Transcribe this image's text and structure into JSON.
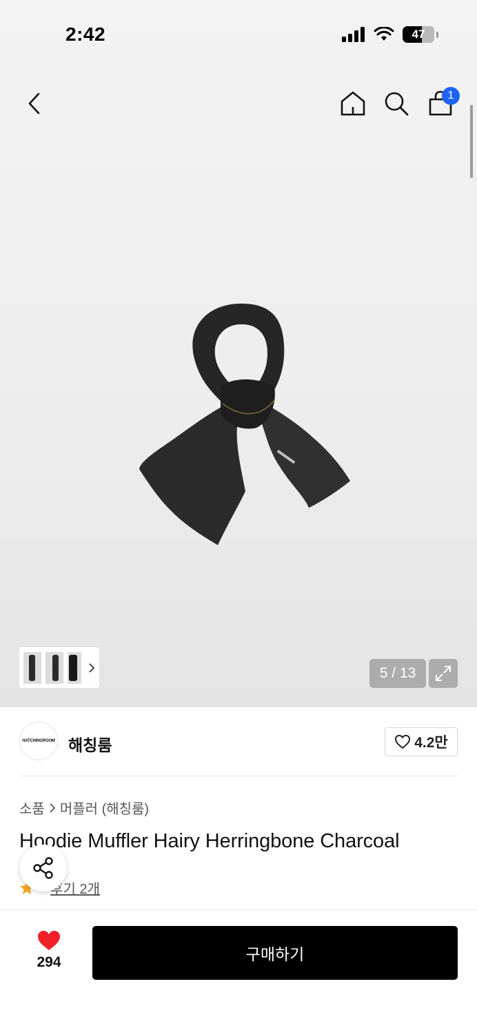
{
  "status_bar": {
    "time": "2:42",
    "battery": "47"
  },
  "nav": {
    "cart_count": "1"
  },
  "gallery": {
    "counter": "5 / 13",
    "current_index": 5,
    "total": 13
  },
  "brand": {
    "logo_text": "HATCHINGROOM",
    "name": "해칭룸",
    "likes": "4.2만"
  },
  "breadcrumb": {
    "category": "소품",
    "subcategory": "머플러 (해칭룸)"
  },
  "product": {
    "title": "Hoodie Muffler Hairy Herringbone Charcoal",
    "rating": "5",
    "reviews": "후기 2개"
  },
  "bottom_bar": {
    "wish_count": "294",
    "buy_label": "구매하기"
  },
  "colors": {
    "cart_badge": "#1f63f5",
    "wish_heart": "#f0202a",
    "buy_button": "#000000",
    "star": "#f5a623"
  }
}
